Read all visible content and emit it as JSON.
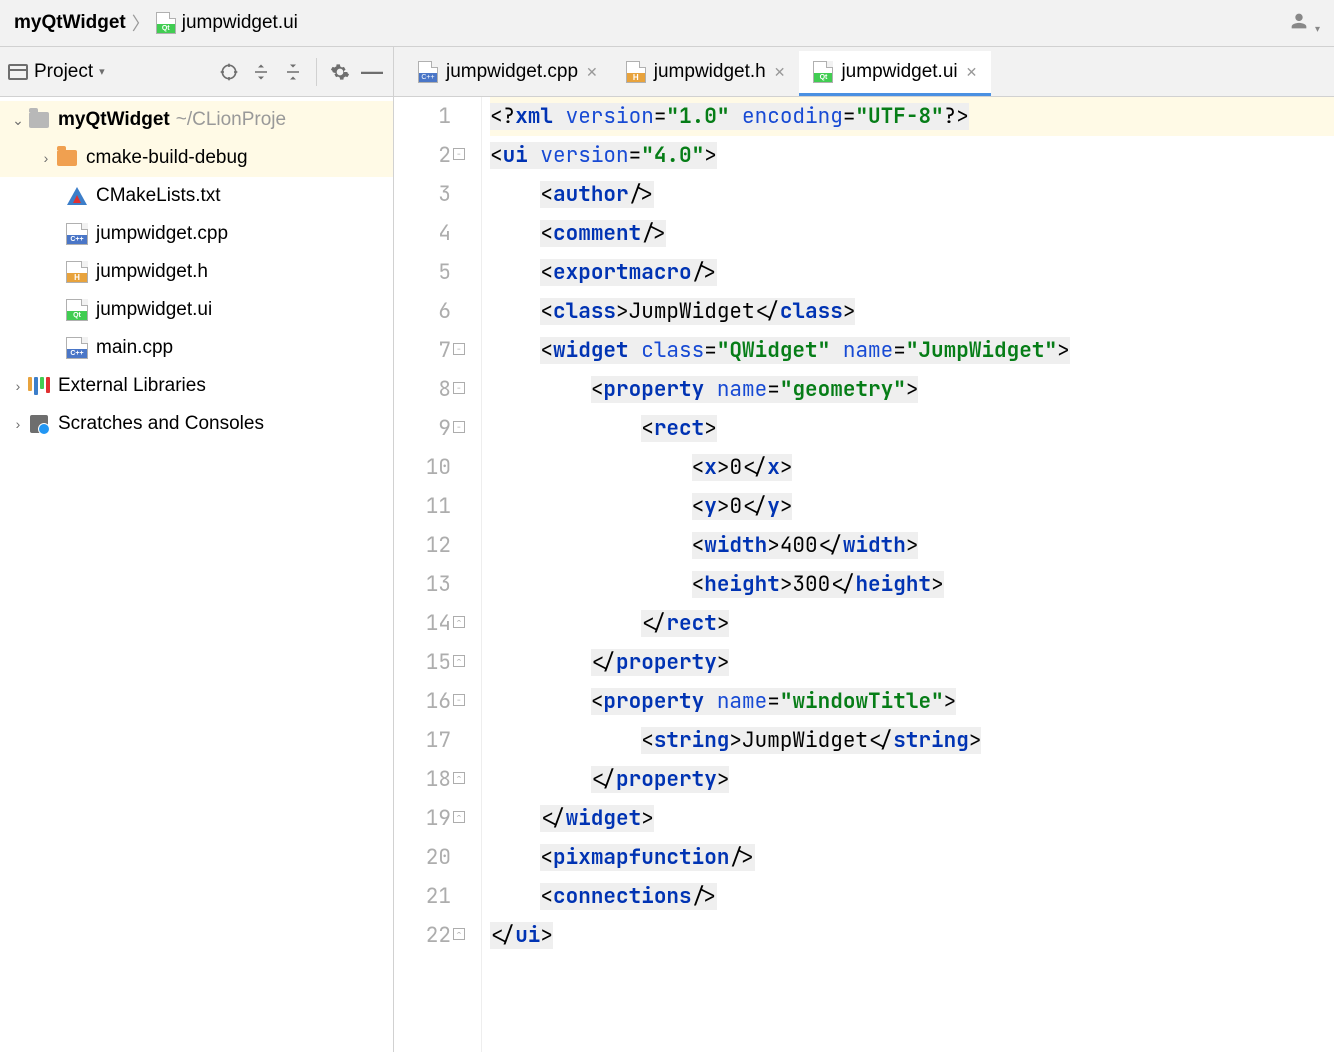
{
  "breadcrumb": {
    "root": "myQtWidget",
    "file": "jumpwidget.ui"
  },
  "sidebar": {
    "label": "Project",
    "project_name": "myQtWidget",
    "project_path": "~/CLionProje",
    "folder": "cmake-build-debug",
    "files": [
      "CMakeLists.txt",
      "jumpwidget.cpp",
      "jumpwidget.h",
      "jumpwidget.ui",
      "main.cpp"
    ],
    "external": "External Libraries",
    "scratches": "Scratches and Consoles"
  },
  "tabs": [
    {
      "label": "jumpwidget.cpp",
      "type": "cpp"
    },
    {
      "label": "jumpwidget.h",
      "type": "h"
    },
    {
      "label": "jumpwidget.ui",
      "type": "qt",
      "active": true
    }
  ],
  "code": {
    "lines": [
      {
        "n": 1,
        "hl": true,
        "tokens": [
          {
            "t": "cursor"
          },
          {
            "t": "pi",
            "v": "<?"
          },
          {
            "t": "tag",
            "v": "xml "
          },
          {
            "t": "attr",
            "v": "version"
          },
          {
            "t": "pi",
            "v": "="
          },
          {
            "t": "str",
            "v": "\"1.0\""
          },
          {
            "t": "pi",
            "v": " "
          },
          {
            "t": "attr",
            "v": "encoding"
          },
          {
            "t": "pi",
            "v": "="
          },
          {
            "t": "str",
            "v": "\"UTF-8\""
          },
          {
            "t": "pi",
            "v": "?>"
          }
        ]
      },
      {
        "n": 2,
        "fold": "-",
        "indent": 0,
        "tokens": [
          {
            "t": "bg",
            "v": "<"
          },
          {
            "t": "tag",
            "v": "ui "
          },
          {
            "t": "attr",
            "v": "version"
          },
          {
            "t": "bg",
            "v": "="
          },
          {
            "t": "str",
            "v": "\"4.0\""
          },
          {
            "t": "bg",
            "v": ">"
          }
        ]
      },
      {
        "n": 3,
        "indent": 1,
        "tokens": [
          {
            "t": "bg",
            "v": "<"
          },
          {
            "t": "tag",
            "v": "author"
          },
          {
            "t": "bg",
            "v": "/>"
          }
        ]
      },
      {
        "n": 4,
        "indent": 1,
        "tokens": [
          {
            "t": "bg",
            "v": "<"
          },
          {
            "t": "tag",
            "v": "comment"
          },
          {
            "t": "bg",
            "v": "/>"
          }
        ]
      },
      {
        "n": 5,
        "indent": 1,
        "tokens": [
          {
            "t": "bg",
            "v": "<"
          },
          {
            "t": "tag",
            "v": "exportmacro"
          },
          {
            "t": "bg",
            "v": "/>"
          }
        ]
      },
      {
        "n": 6,
        "indent": 1,
        "tokens": [
          {
            "t": "bg",
            "v": "<"
          },
          {
            "t": "tag",
            "v": "class"
          },
          {
            "t": "bg",
            "v": ">"
          },
          {
            "t": "txt",
            "v": "JumpWidget"
          },
          {
            "t": "bg",
            "v": "</"
          },
          {
            "t": "tag",
            "v": "class"
          },
          {
            "t": "bg",
            "v": ">"
          }
        ]
      },
      {
        "n": 7,
        "fold": "-",
        "indent": 1,
        "tokens": [
          {
            "t": "bg",
            "v": "<"
          },
          {
            "t": "tag",
            "v": "widget "
          },
          {
            "t": "attr",
            "v": "class"
          },
          {
            "t": "bg",
            "v": "="
          },
          {
            "t": "str",
            "v": "\"QWidget\""
          },
          {
            "t": "bg",
            "v": " "
          },
          {
            "t": "attr",
            "v": "name"
          },
          {
            "t": "bg",
            "v": "="
          },
          {
            "t": "str",
            "v": "\"JumpWidget\""
          },
          {
            "t": "bg",
            "v": ">"
          }
        ]
      },
      {
        "n": 8,
        "fold": "-",
        "indent": 2,
        "tokens": [
          {
            "t": "bg",
            "v": "<"
          },
          {
            "t": "tag",
            "v": "property "
          },
          {
            "t": "attr",
            "v": "name"
          },
          {
            "t": "bg",
            "v": "="
          },
          {
            "t": "str",
            "v": "\"geometry\""
          },
          {
            "t": "bg",
            "v": ">"
          }
        ]
      },
      {
        "n": 9,
        "fold": "-",
        "indent": 3,
        "tokens": [
          {
            "t": "bg",
            "v": "<"
          },
          {
            "t": "tag",
            "v": "rect"
          },
          {
            "t": "bg",
            "v": ">"
          }
        ]
      },
      {
        "n": 10,
        "indent": 4,
        "tokens": [
          {
            "t": "bg",
            "v": "<"
          },
          {
            "t": "tag",
            "v": "x"
          },
          {
            "t": "bg",
            "v": ">"
          },
          {
            "t": "txt",
            "v": "0"
          },
          {
            "t": "bg",
            "v": "</"
          },
          {
            "t": "tag",
            "v": "x"
          },
          {
            "t": "bg",
            "v": ">"
          }
        ]
      },
      {
        "n": 11,
        "indent": 4,
        "tokens": [
          {
            "t": "bg",
            "v": "<"
          },
          {
            "t": "tag",
            "v": "y"
          },
          {
            "t": "bg",
            "v": ">"
          },
          {
            "t": "txt",
            "v": "0"
          },
          {
            "t": "bg",
            "v": "</"
          },
          {
            "t": "tag",
            "v": "y"
          },
          {
            "t": "bg",
            "v": ">"
          }
        ]
      },
      {
        "n": 12,
        "indent": 4,
        "tokens": [
          {
            "t": "bg",
            "v": "<"
          },
          {
            "t": "tag",
            "v": "width"
          },
          {
            "t": "bg",
            "v": ">"
          },
          {
            "t": "txt",
            "v": "400"
          },
          {
            "t": "bg",
            "v": "</"
          },
          {
            "t": "tag",
            "v": "width"
          },
          {
            "t": "bg",
            "v": ">"
          }
        ]
      },
      {
        "n": 13,
        "indent": 4,
        "tokens": [
          {
            "t": "bg",
            "v": "<"
          },
          {
            "t": "tag",
            "v": "height"
          },
          {
            "t": "bg",
            "v": ">"
          },
          {
            "t": "txt",
            "v": "300"
          },
          {
            "t": "bg",
            "v": "</"
          },
          {
            "t": "tag",
            "v": "height"
          },
          {
            "t": "bg",
            "v": ">"
          }
        ]
      },
      {
        "n": 14,
        "fold": "^",
        "indent": 3,
        "tokens": [
          {
            "t": "bg",
            "v": "</"
          },
          {
            "t": "tag",
            "v": "rect"
          },
          {
            "t": "bg",
            "v": ">"
          }
        ]
      },
      {
        "n": 15,
        "fold": "^",
        "indent": 2,
        "tokens": [
          {
            "t": "bg",
            "v": "</"
          },
          {
            "t": "tag",
            "v": "property"
          },
          {
            "t": "bg",
            "v": ">"
          }
        ]
      },
      {
        "n": 16,
        "fold": "-",
        "indent": 2,
        "tokens": [
          {
            "t": "bg",
            "v": "<"
          },
          {
            "t": "tag",
            "v": "property "
          },
          {
            "t": "attr",
            "v": "name"
          },
          {
            "t": "bg",
            "v": "="
          },
          {
            "t": "str",
            "v": "\"windowTitle\""
          },
          {
            "t": "bg",
            "v": ">"
          }
        ]
      },
      {
        "n": 17,
        "indent": 3,
        "tokens": [
          {
            "t": "bg",
            "v": "<"
          },
          {
            "t": "tag",
            "v": "string"
          },
          {
            "t": "bg",
            "v": ">"
          },
          {
            "t": "txt",
            "v": "JumpWidget"
          },
          {
            "t": "bg",
            "v": "</"
          },
          {
            "t": "tag",
            "v": "string"
          },
          {
            "t": "bg",
            "v": ">"
          }
        ]
      },
      {
        "n": 18,
        "fold": "^",
        "indent": 2,
        "tokens": [
          {
            "t": "bg",
            "v": "</"
          },
          {
            "t": "tag",
            "v": "property"
          },
          {
            "t": "bg",
            "v": ">"
          }
        ]
      },
      {
        "n": 19,
        "fold": "^",
        "indent": 1,
        "tokens": [
          {
            "t": "bg",
            "v": "</"
          },
          {
            "t": "tag",
            "v": "widget"
          },
          {
            "t": "bg",
            "v": ">"
          }
        ]
      },
      {
        "n": 20,
        "indent": 1,
        "tokens": [
          {
            "t": "bg",
            "v": "<"
          },
          {
            "t": "tag",
            "v": "pixmapfunction"
          },
          {
            "t": "bg",
            "v": "/>"
          }
        ]
      },
      {
        "n": 21,
        "indent": 1,
        "tokens": [
          {
            "t": "bg",
            "v": "<"
          },
          {
            "t": "tag",
            "v": "connections"
          },
          {
            "t": "bg",
            "v": "/>"
          }
        ]
      },
      {
        "n": 22,
        "fold": "^",
        "indent": 0,
        "tokens": [
          {
            "t": "bg",
            "v": "</"
          },
          {
            "t": "tag",
            "v": "ui"
          },
          {
            "t": "bg",
            "v": ">"
          }
        ]
      }
    ]
  }
}
